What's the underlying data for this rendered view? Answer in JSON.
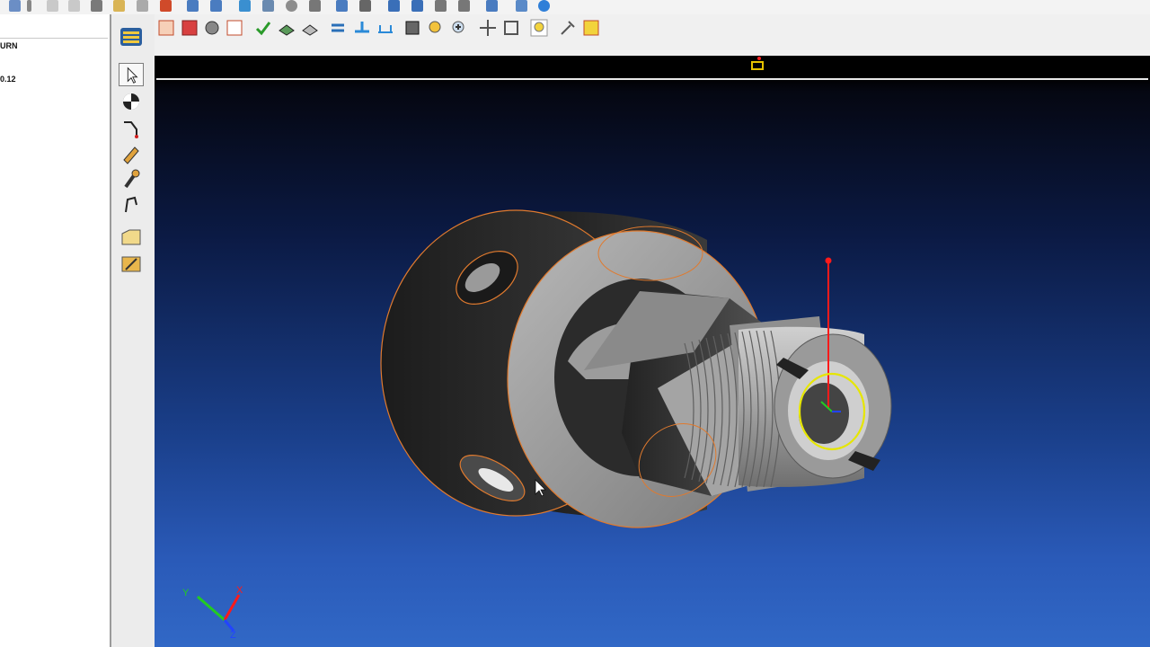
{
  "left_panel": {
    "item_1": "URN",
    "item_2": "0.12"
  },
  "quick_access_icons": [
    "print-icon",
    "undo-icon",
    "redo-icon",
    "cut-icon",
    "copy-icon",
    "paste-icon",
    "delete-icon",
    "open-icon",
    "save-icon",
    "list-icon",
    "edit-icon",
    "clock-icon",
    "tree-icon",
    "import-icon",
    "export-icon",
    "grid-icon",
    "chart-icon",
    "settings-icon",
    "window-icon",
    "home-icon",
    "help-icon"
  ],
  "graphics_toolbar_icons": [
    "box-select-icon",
    "fill-icon",
    "rotate-view-icon",
    "sketch-icon",
    "check-icon",
    "layers-icon",
    "stack-icon",
    "swap-icon",
    "align-icon",
    "dimension-icon",
    "zoom-fit-icon",
    "zoom-icon",
    "zoom-in-icon",
    "pan-icon",
    "frame-icon",
    "light-icon",
    "tools-icon",
    "cube-icon"
  ],
  "vertical_tools": [
    "select-arrow-icon",
    "sphere-icon",
    "polyline-icon",
    "pen-icon",
    "wrench-icon",
    "cutting-tool-icon",
    "folder-icon",
    "edit-tool-icon"
  ],
  "axes": {
    "x": "X",
    "y": "Y",
    "z": "Z"
  },
  "colors": {
    "part_edge": "#e07a2e",
    "selection_circle": "#e6e600",
    "axis_red": "#ff1a1a",
    "axis_green": "#22cc22",
    "axis_blue": "#2244ff"
  }
}
